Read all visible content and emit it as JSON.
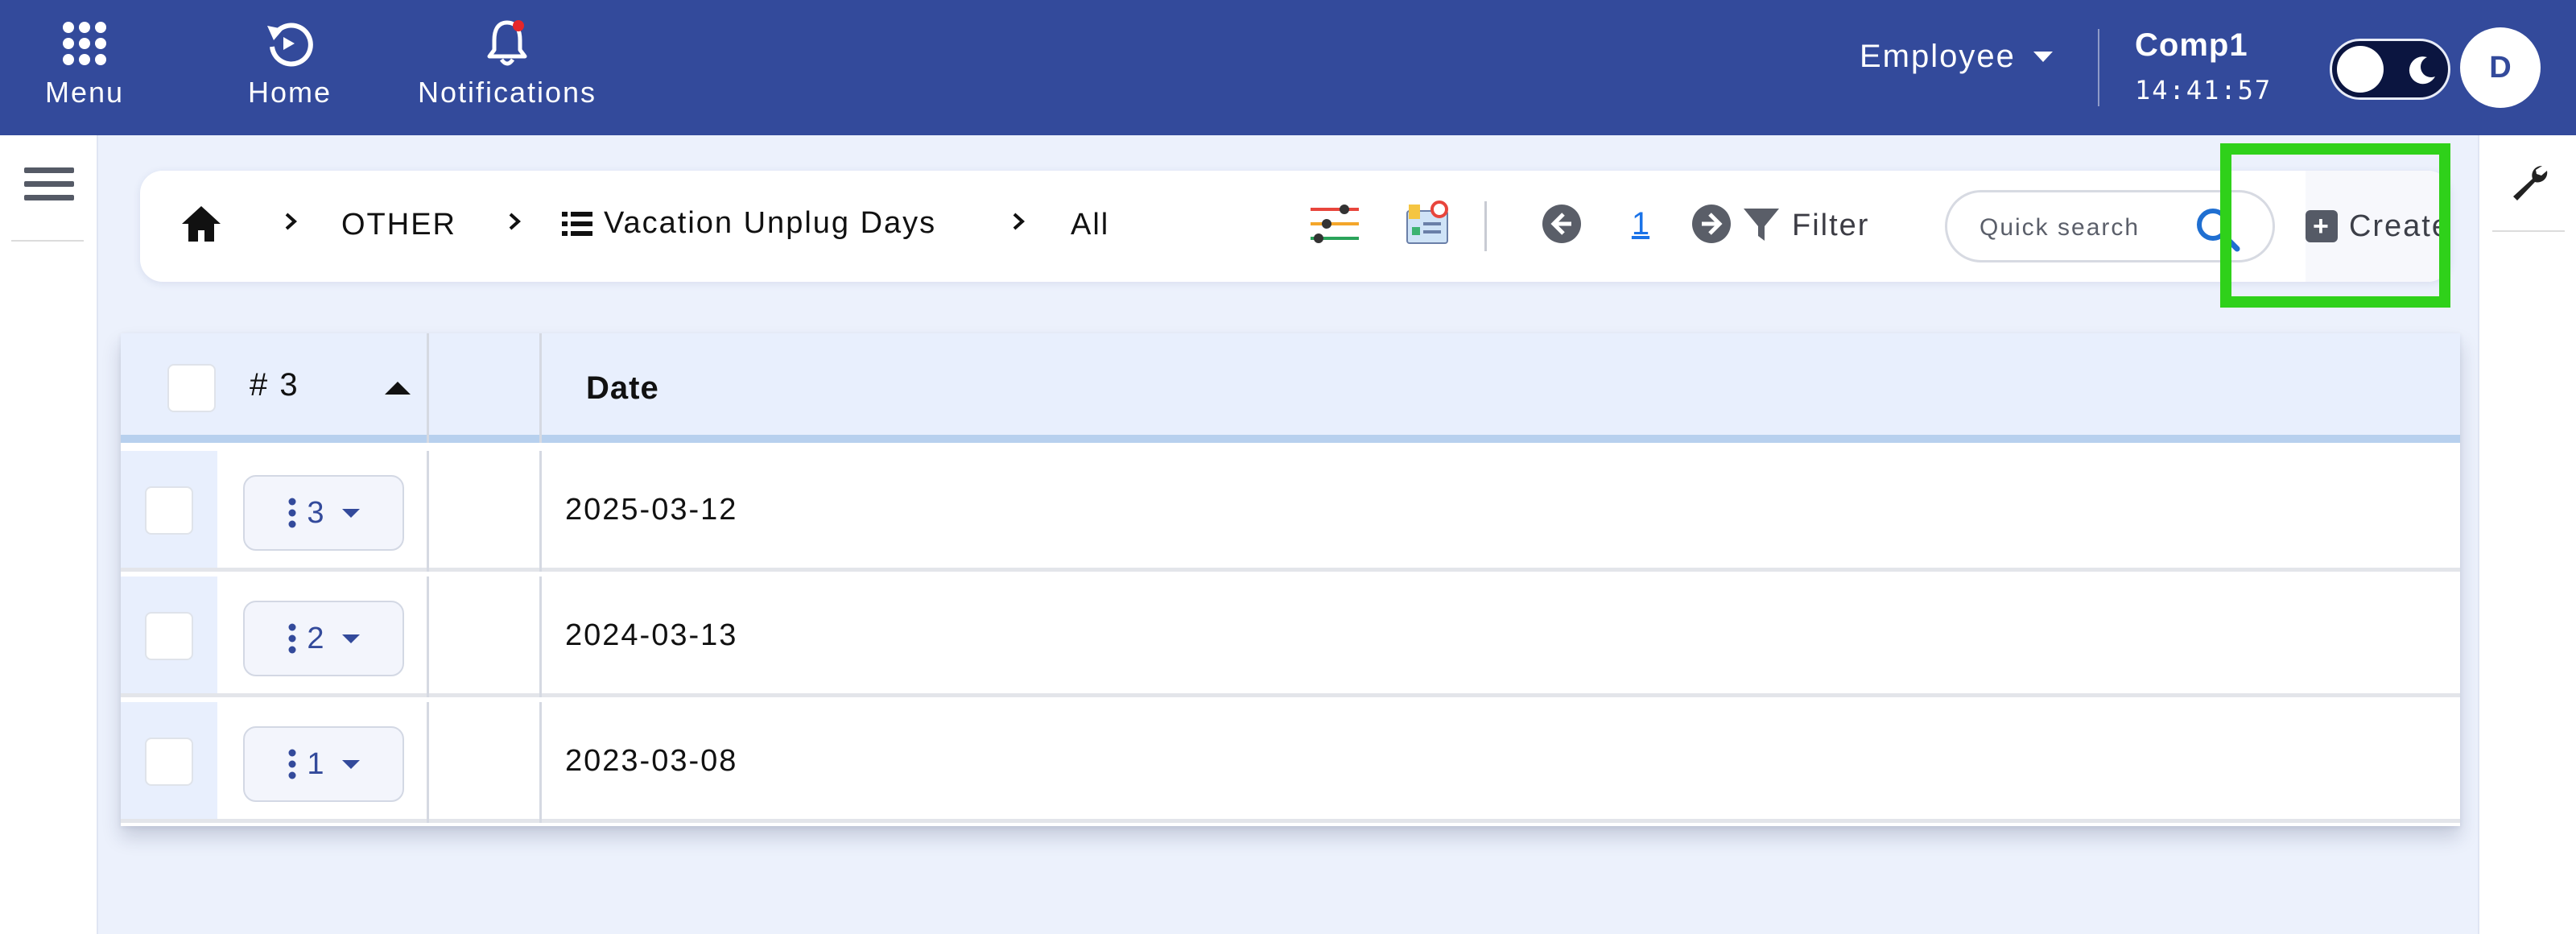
{
  "topbar": {
    "menu_label": "Menu",
    "home_label": "Home",
    "notifications_label": "Notifications",
    "role": "Employee",
    "company_name": "Comp1",
    "clock": "14:41:57",
    "avatar_initial": "D",
    "brand_color": "#334a9b"
  },
  "breadcrumb": {
    "level1": "OTHER",
    "level2": "Vacation Unplug Days",
    "level3": "All"
  },
  "toolbar": {
    "page_number": "1",
    "filter_label": "Filter",
    "search_placeholder": "Quick search",
    "create_label": "Create",
    "highlight_color": "#2fd11a"
  },
  "table": {
    "count_label": "# 3",
    "date_header": "Date",
    "rows": [
      {
        "number": "3",
        "date": "2025-03-12"
      },
      {
        "number": "2",
        "date": "2024-03-13"
      },
      {
        "number": "1",
        "date": "2023-03-08"
      }
    ]
  },
  "icons": [
    "menu-grid-icon",
    "home-refresh-icon",
    "bell-icon",
    "moon-icon",
    "hamburger-icon",
    "wrench-icon",
    "home-icon",
    "chevron-right-icon",
    "list-icon",
    "sliders-icon",
    "report-icon",
    "arrow-left-icon",
    "arrow-right-icon",
    "filter-icon",
    "search-icon",
    "plus-icon",
    "kebab-icon",
    "caret-down-icon",
    "sort-up-icon"
  ]
}
